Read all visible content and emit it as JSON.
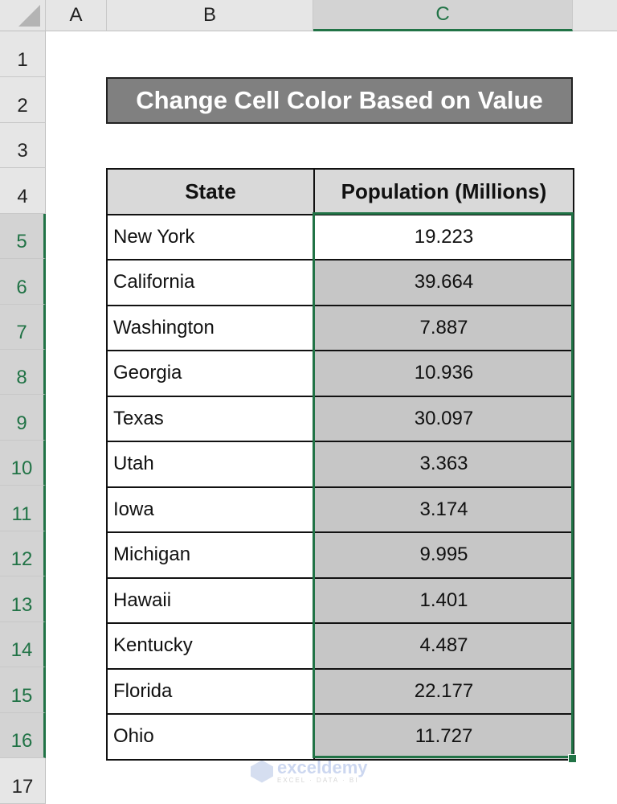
{
  "sheet": {
    "columns": [
      "A",
      "B",
      "C"
    ],
    "selected_column": "C",
    "rows": [
      "1",
      "2",
      "3",
      "4",
      "5",
      "6",
      "7",
      "8",
      "9",
      "10",
      "11",
      "12",
      "13",
      "14",
      "15",
      "16",
      "17"
    ]
  },
  "title": "Change Cell Color Based on Value",
  "table": {
    "headers": [
      "State",
      "Population (Millions)"
    ],
    "rows": [
      {
        "state": "New York",
        "population": "19.223",
        "highlighted": false
      },
      {
        "state": "California",
        "population": "39.664",
        "highlighted": true
      },
      {
        "state": "Washington",
        "population": "7.887",
        "highlighted": true
      },
      {
        "state": "Georgia",
        "population": "10.936",
        "highlighted": true
      },
      {
        "state": "Texas",
        "population": "30.097",
        "highlighted": true
      },
      {
        "state": "Utah",
        "population": "3.363",
        "highlighted": true
      },
      {
        "state": "Iowa",
        "population": "3.174",
        "highlighted": true
      },
      {
        "state": "Michigan",
        "population": "9.995",
        "highlighted": true
      },
      {
        "state": "Hawaii",
        "population": "1.401",
        "highlighted": true
      },
      {
        "state": "Kentucky",
        "population": "4.487",
        "highlighted": true
      },
      {
        "state": "Florida",
        "population": "22.177",
        "highlighted": true
      },
      {
        "state": "Ohio",
        "population": "11.727",
        "highlighted": true
      }
    ]
  },
  "colors": {
    "accent": "#217346",
    "title_fill": "#808080",
    "header_fill": "#d9d9d9",
    "highlight_fill": "#c6c6c6"
  },
  "watermark": {
    "name": "exceldemy",
    "tagline": "EXCEL · DATA · BI"
  }
}
